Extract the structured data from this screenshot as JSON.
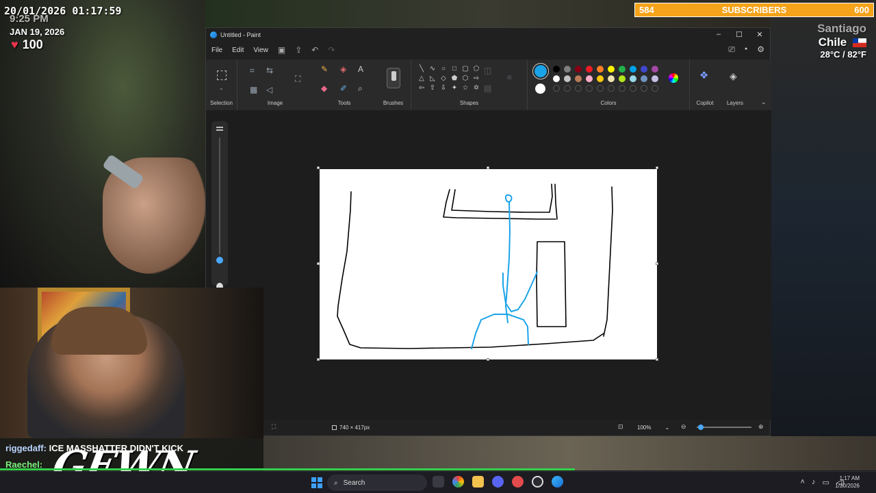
{
  "overlay": {
    "datetime": "20/01/2026 01:17:59",
    "stream_time": "9:25 PM",
    "date_label": "JAN 19, 2026",
    "heart_count": "100",
    "subs_current": "584",
    "subs_label": "SUBSCRIBERS",
    "subs_goal": "600",
    "city": "Santiago",
    "country": "Chile",
    "temperature": "28°C / 82°F",
    "brand": "GEWN"
  },
  "chat": {
    "user1": "riggedaff:",
    "msg1": "ICE MASSHATTER DIDN'T KICK",
    "user2": "Raechel:"
  },
  "paint": {
    "title": "Untitled - Paint",
    "menu": {
      "file": "File",
      "edit": "Edit",
      "view": "View"
    },
    "groups": {
      "selection": "Selection",
      "image": "Image",
      "tools": "Tools",
      "brushes": "Brushes",
      "shapes": "Shapes",
      "colors": "Colors",
      "copilot": "Copilot",
      "layers": "Layers"
    },
    "colors": {
      "primary": "#1aa3e8",
      "secondary": "#ffffff",
      "palette_row1": [
        "#000000",
        "#7f7f7f",
        "#880015",
        "#ed1c24",
        "#ff7f27",
        "#fff200",
        "#22b14c",
        "#00a2e8",
        "#3f48cc",
        "#a349a4"
      ],
      "palette_row2": [
        "#ffffff",
        "#c3c3c3",
        "#b97a57",
        "#ffaec9",
        "#ffc90e",
        "#efe4b0",
        "#b5e61d",
        "#99d9ea",
        "#7092be",
        "#c8bfe7"
      ]
    },
    "status": {
      "canvas_size": "740 × 417px",
      "zoom": "100%"
    },
    "drawing": {
      "black_stroke": "#000000",
      "blue_stroke": "#1aa3e8"
    }
  },
  "taskbar": {
    "search": "Search",
    "time": "1:17 AM",
    "date": "1/20/2026"
  }
}
